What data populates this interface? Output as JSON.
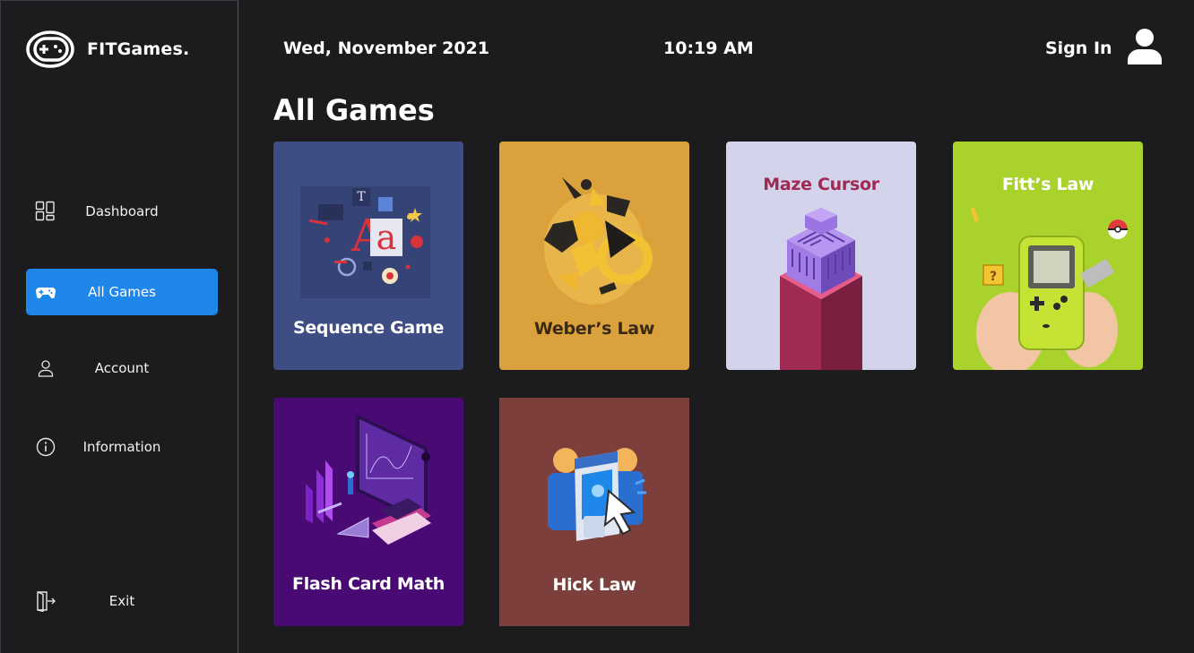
{
  "brand": {
    "name": "FITGames."
  },
  "sidebar": {
    "items": [
      {
        "label": "Dashboard"
      },
      {
        "label": "All Games"
      },
      {
        "label": "Account"
      },
      {
        "label": "Information"
      },
      {
        "label": "Exit"
      }
    ]
  },
  "header": {
    "date": "Wed, November 2021",
    "time": "10:19 AM",
    "signin_label": "Sign In"
  },
  "main": {
    "title": "All Games",
    "games": [
      {
        "title": "Sequence Game",
        "bg": "#3f4d85",
        "title_color": "#ffffff"
      },
      {
        "title": "Weber’s Law",
        "bg": "#dba13d",
        "title_color": "#3a2a13"
      },
      {
        "title": "Maze Cursor",
        "bg": "#d3d3ec",
        "title_color": "#a02a52"
      },
      {
        "title": "Fitt’s Law",
        "bg": "#a9d22c",
        "title_color": "#ffffff"
      },
      {
        "title": "Flash Card Math",
        "bg": "#4a0a74",
        "title_color": "#ffffff"
      },
      {
        "title": "Hick Law",
        "bg": "#7d3f3b",
        "title_color": "#ffffff"
      }
    ]
  },
  "icons": {
    "brand": "gamepad-logo-icon",
    "dashboard": "grid-icon",
    "all_games": "gamepad-icon",
    "account": "user-outline-icon",
    "information": "info-circle-icon",
    "exit": "door-exit-icon",
    "user": "user-avatar-icon"
  },
  "colors": {
    "background": "#1c1c1f",
    "accent": "#1f87ea"
  }
}
